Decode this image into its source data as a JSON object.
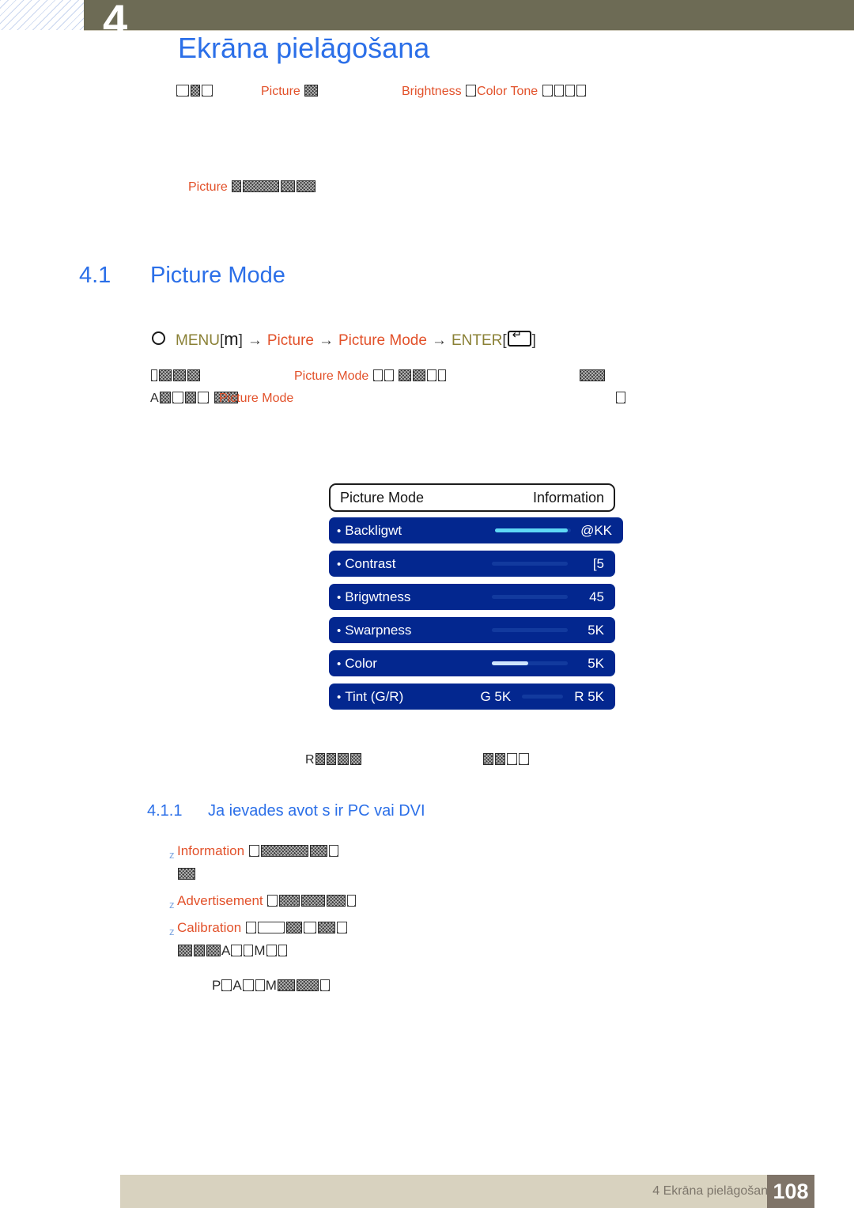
{
  "header": {
    "chapter_number": "4",
    "title": "Ekrāna pielāgošana"
  },
  "intro": {
    "line1_part_picture": "Picture",
    "line1_part_brightness": "Brightness",
    "line1_part_colortone": "Color Tone",
    "line2_picture": "Picture"
  },
  "section": {
    "number": "4.1",
    "title": "Picture Mode"
  },
  "menu_path": {
    "menu_label": "MENU",
    "menu_key": "m",
    "bracket_open": "[",
    "bracket_close": "]",
    "arrow": "→",
    "item1": "Picture",
    "item2": "Picture Mode",
    "enter_label": "ENTER"
  },
  "body": {
    "para1_inline_picture_mode": "Picture Mode",
    "para2_leading_letter": "A",
    "para2_inline_picture_mode": "Picture Mode"
  },
  "osd": {
    "header_left": "Picture Mode",
    "header_right": "Information",
    "rows": [
      {
        "label": "Backligwt",
        "value": "@KK",
        "fill_pct": 96,
        "fill_color": "#5fd8f5",
        "slider": "full"
      },
      {
        "label": "Contrast",
        "value": "[5",
        "fill_pct": 0,
        "fill_color": "#5fd8f5",
        "slider": "full"
      },
      {
        "label": "Brigwtness",
        "value": "45",
        "fill_pct": 0,
        "fill_color": "#5fd8f5",
        "slider": "full"
      },
      {
        "label": "Swarpness",
        "value": "5K",
        "fill_pct": 0,
        "fill_color": "#5fd8f5",
        "slider": "full"
      },
      {
        "label": "Color",
        "value": "5K",
        "fill_pct": 48,
        "fill_color": "#cfe6ff",
        "slider": "full"
      },
      {
        "label": "Tint (G/R)",
        "value": "R 5K",
        "left_value": "G 5K",
        "fill_pct": 0,
        "fill_color": "#5fd8f5",
        "slider": "short"
      }
    ],
    "bullet": "•"
  },
  "subsection": {
    "number": "4.1.1",
    "title": "Ja ievades avot s ir PC vai DVI"
  },
  "bullets": {
    "marker": "z",
    "item1": "Information",
    "item2": "Advertisement",
    "item3": "Calibration"
  },
  "tail": {
    "line1_letter": "A",
    "line2_letter_p": "P",
    "line2_letter_a": "A"
  },
  "footer": {
    "text": "4 Ekrāna pielāgošana",
    "page": "108"
  },
  "colors": {
    "olive_band": "#6d6b55",
    "title_blue": "#2b6fe8",
    "accent_orange": "#e2512a",
    "osd_blue": "#03278f",
    "slider_cyan": "#5fd8f5",
    "footer_beige": "#d8d2bf",
    "footer_page_box": "#7f7468"
  }
}
